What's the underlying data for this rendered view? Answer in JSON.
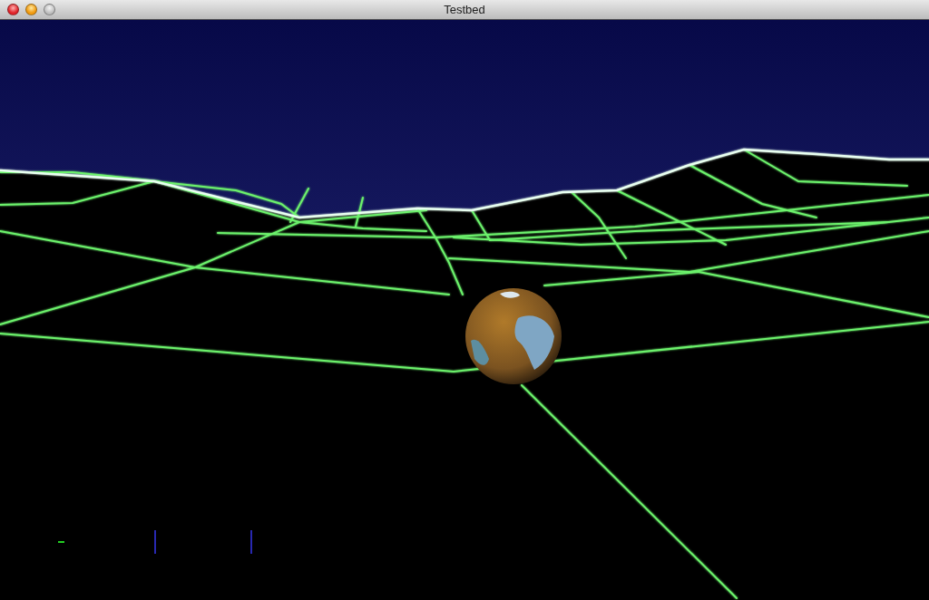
{
  "window": {
    "title": "Testbed"
  }
}
